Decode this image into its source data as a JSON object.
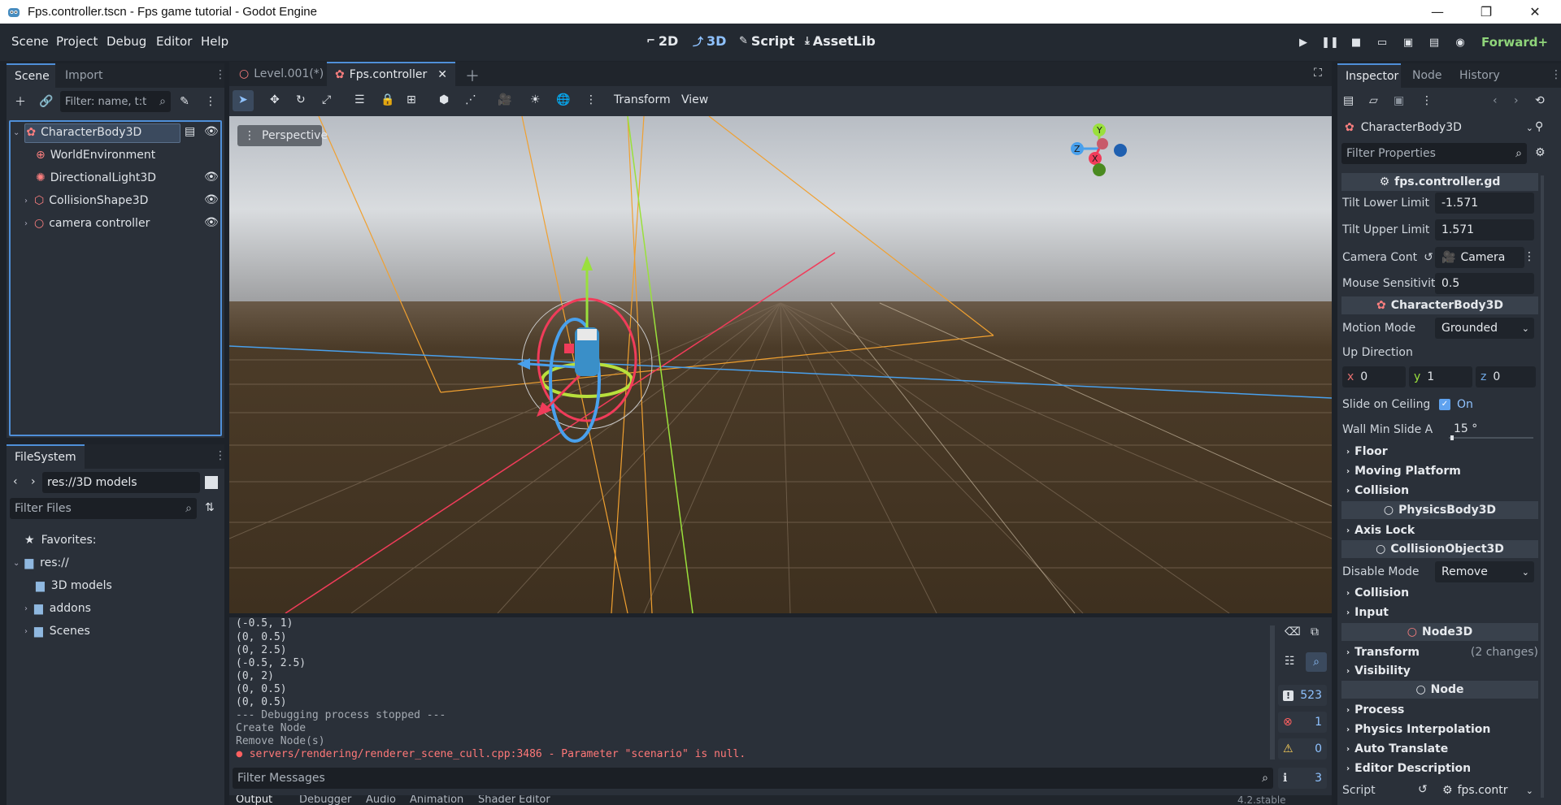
{
  "window": {
    "title": "Fps.controller.tscn - Fps game tutorial - Godot Engine",
    "minimize": "—",
    "maximize": "❐",
    "close": "✕"
  },
  "menubar": {
    "items": [
      "Scene",
      "Project",
      "Debug",
      "Editor",
      "Help"
    ],
    "modes": [
      "2D",
      "3D",
      "Script",
      "AssetLib"
    ],
    "renderer": "Forward+"
  },
  "scene_dock": {
    "tabs": [
      "Scene",
      "Import"
    ],
    "filter_placeholder": "Filter: name, t:t",
    "nodes": [
      {
        "label": "CharacterBody3D"
      },
      {
        "label": "WorldEnvironment"
      },
      {
        "label": "DirectionalLight3D"
      },
      {
        "label": "CollisionShape3D"
      },
      {
        "label": "camera controller"
      }
    ]
  },
  "filesystem": {
    "tab": "FileSystem",
    "path": "res://3D models",
    "filter_placeholder": "Filter Files",
    "items": [
      {
        "label": "Favorites:"
      },
      {
        "label": "res://"
      },
      {
        "label": "3D models"
      },
      {
        "label": "addons"
      },
      {
        "label": "Scenes"
      }
    ]
  },
  "editor_tabs": [
    {
      "label": "Level.001(*)"
    },
    {
      "label": "Fps.controller"
    }
  ],
  "viewport_toolbar": {
    "transform": "Transform",
    "view": "View",
    "perspective": "Perspective"
  },
  "gizmo": {
    "y": "Y",
    "z": "Z",
    "x": "X"
  },
  "output": {
    "lines": [
      "(-0.5, 1)",
      "(0, 0.5)",
      "(0, 2.5)",
      "(-0.5, 2.5)",
      "(0, 2)",
      "(0, 0.5)",
      "(0, 0.5)",
      "--- Debugging process stopped ---",
      "Create Node",
      "Remove Node(s)"
    ],
    "error_line": "servers/rendering/renderer_scene_cull.cpp:3486 - Parameter \"scenario\" is null.",
    "filter_placeholder": "Filter Messages",
    "counts": {
      "messages": "523",
      "errors": "1",
      "warnings": "0",
      "info": "3"
    },
    "bottom_tabs": [
      "Output",
      "Debugger",
      "Audio",
      "Animation",
      "Shader Editor"
    ],
    "version": "4.2.stable"
  },
  "inspector": {
    "tabs": [
      "Inspector",
      "Node",
      "History"
    ],
    "node": "CharacterBody3D",
    "filter_placeholder": "Filter Properties",
    "script_header": "fps.controller.gd",
    "tilt_lower": {
      "label": "Tilt Lower Limit",
      "value": "-1.571"
    },
    "tilt_upper": {
      "label": "Tilt Upper Limit",
      "value": "1.571"
    },
    "camera_cont": {
      "label": "Camera Cont",
      "value": "Camera"
    },
    "mouse_sens": {
      "label": "Mouse Sensitivit",
      "value": "0.5"
    },
    "body_header": "CharacterBody3D",
    "motion_mode": {
      "label": "Motion Mode",
      "value": "Grounded"
    },
    "up_direction": {
      "label": "Up Direction",
      "x": "0",
      "y": "1",
      "z": "0"
    },
    "slide_ceiling": {
      "label": "Slide on Ceiling",
      "value": "On"
    },
    "wall_min": {
      "label": "Wall Min Slide A",
      "value": "15 °"
    },
    "sections1": [
      "Floor",
      "Moving Platform",
      "Collision"
    ],
    "physics_header": "PhysicsBody3D",
    "axis_lock": "Axis Lock",
    "collision_header": "CollisionObject3D",
    "disable_mode": {
      "label": "Disable Mode",
      "value": "Remove"
    },
    "sections2": [
      "Collision",
      "Input"
    ],
    "node3d_header": "Node3D",
    "transform": {
      "label": "Transform",
      "changes": "(2 changes)"
    },
    "visibility": "Visibility",
    "node_header": "Node",
    "sections3": [
      "Process",
      "Physics Interpolation",
      "Auto Translate",
      "Editor Description"
    ],
    "script": {
      "label": "Script",
      "value": "fps.contr"
    }
  }
}
